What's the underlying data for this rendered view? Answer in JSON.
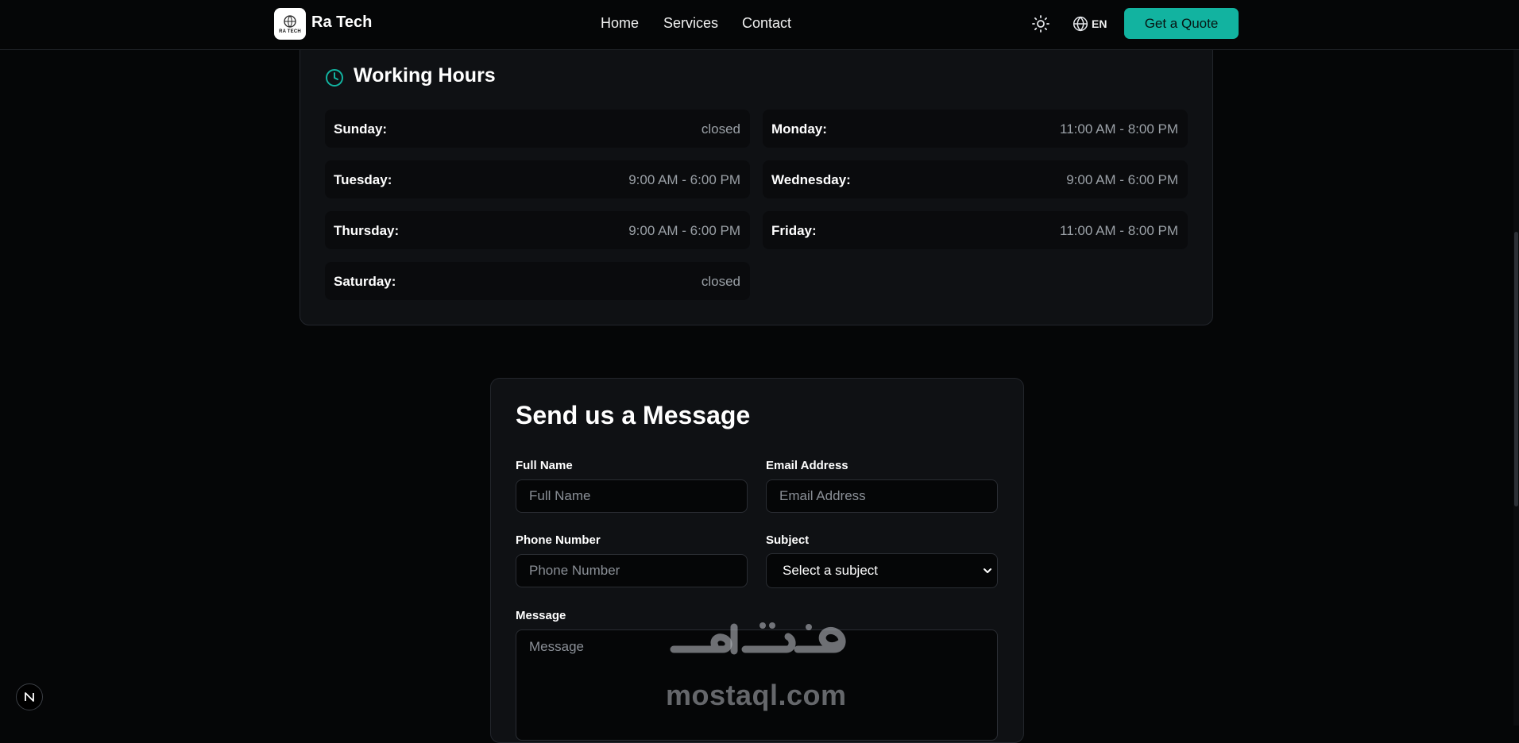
{
  "colors": {
    "accent": "#12b3a0",
    "background": "#050607",
    "card": "#0f1114",
    "row": "#0a0b0d",
    "muted_text": "#9aa0a6"
  },
  "header": {
    "logo_mark": "RA TECH",
    "brand": "Ra Tech",
    "nav": [
      "Home",
      "Services",
      "Contact"
    ],
    "theme_icon": "sun-icon",
    "language": "EN",
    "language_icon": "globe-icon",
    "cta": "Get a Quote"
  },
  "hours": {
    "icon": "clock-icon",
    "title": "Working Hours",
    "days": [
      {
        "day": "Sunday:",
        "time": "closed"
      },
      {
        "day": "Monday:",
        "time": "11:00 AM - 8:00 PM"
      },
      {
        "day": "Tuesday:",
        "time": "9:00 AM - 6:00 PM"
      },
      {
        "day": "Wednesday:",
        "time": "9:00 AM - 6:00 PM"
      },
      {
        "day": "Thursday:",
        "time": "9:00 AM - 6:00 PM"
      },
      {
        "day": "Friday:",
        "time": "11:00 AM - 8:00 PM"
      },
      {
        "day": "Saturday:",
        "time": "closed"
      }
    ]
  },
  "form": {
    "title": "Send us a Message",
    "full_name": {
      "label": "Full Name",
      "placeholder": "Full Name",
      "value": ""
    },
    "email": {
      "label": "Email Address",
      "placeholder": "Email Address",
      "value": ""
    },
    "phone": {
      "label": "Phone Number",
      "placeholder": "Phone Number",
      "value": ""
    },
    "subject": {
      "label": "Subject",
      "selected": "Select a subject"
    },
    "message": {
      "label": "Message",
      "placeholder": "Message",
      "value": ""
    }
  },
  "watermark": {
    "arabic": "مستقل",
    "latin": "mostaql.com"
  },
  "dev_badge": {
    "label": "N",
    "icon": "nextjs-icon"
  }
}
